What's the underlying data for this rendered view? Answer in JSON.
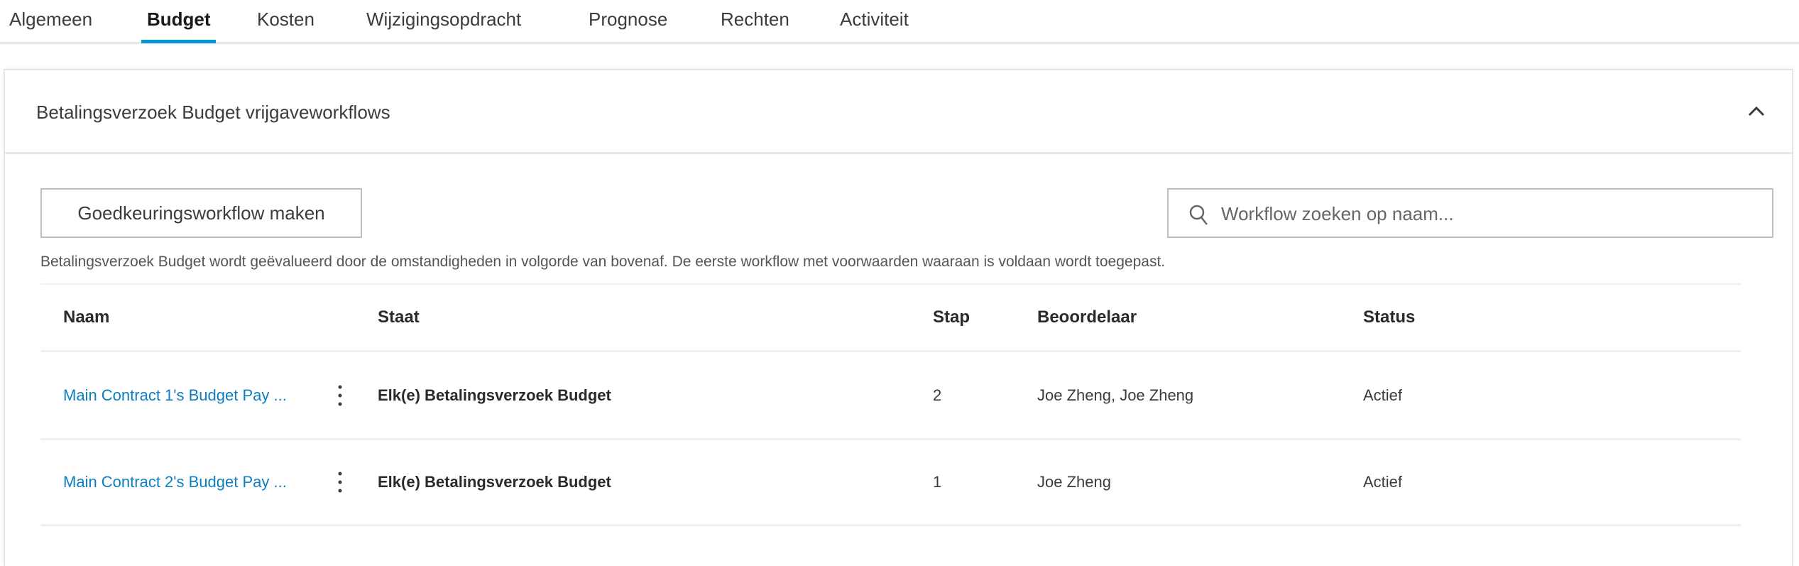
{
  "tabs": [
    {
      "label": "Algemeen",
      "active": false
    },
    {
      "label": "Budget",
      "active": true
    },
    {
      "label": "Kosten",
      "active": false
    },
    {
      "label": "Wijzigingsopdracht",
      "active": false
    },
    {
      "label": "Prognose",
      "active": false
    },
    {
      "label": "Rechten",
      "active": false
    },
    {
      "label": "Activiteit",
      "active": false
    }
  ],
  "section": {
    "title": "Betalingsverzoek Budget vrijgaveworkflows",
    "create_button": "Goedkeuringsworkflow maken",
    "search_placeholder": "Workflow zoeken op naam...",
    "description": "Betalingsverzoek Budget wordt geëvalueerd door de omstandigheden in volgorde van bovenaf. De eerste workflow met voorwaarden waaraan is voldaan wordt toegepast."
  },
  "table": {
    "columns": [
      "Naam",
      "Staat",
      "Stap",
      "Beoordelaar",
      "Status"
    ],
    "rows": [
      {
        "naam": "Main Contract 1's Budget Pay ...",
        "staat": "Elk(e) Betalingsverzoek Budget",
        "stap": "2",
        "beoordelaar": "Joe Zheng, Joe Zheng",
        "status": "Actief"
      },
      {
        "naam": "Main Contract 2's Budget Pay ...",
        "staat": "Elk(e) Betalingsverzoek Budget",
        "stap": "1",
        "beoordelaar": "Joe Zheng",
        "status": "Actief"
      }
    ]
  },
  "colors": {
    "accent": "#0696d7",
    "link": "#0d7fc0"
  }
}
